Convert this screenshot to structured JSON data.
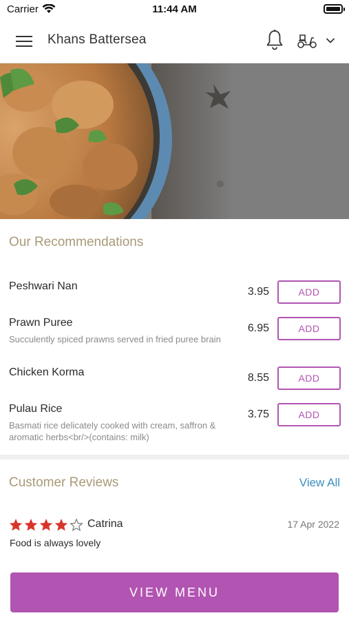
{
  "status_bar": {
    "carrier": "Carrier",
    "time": "11:44 AM"
  },
  "header": {
    "title": "Khans Battersea",
    "icons": [
      "menu-icon",
      "bell-icon",
      "scooter-icon",
      "chevron-down-icon"
    ]
  },
  "recommendations": {
    "title": "Our Recommendations",
    "add_label": "ADD",
    "items": [
      {
        "name": "Peshwari Nan",
        "description": "",
        "price": "3.95"
      },
      {
        "name": "Prawn Puree",
        "description": "Succulently spiced prawns served in fried puree brain",
        "price": "6.95"
      },
      {
        "name": "Chicken Korma",
        "description": "",
        "price": "8.55"
      },
      {
        "name": "Pulau Rice",
        "description": "Basmati rice delicately cooked with cream, saffron & aromatic herbs<br/>(contains: milk)",
        "price": "3.75"
      }
    ]
  },
  "reviews": {
    "title": "Customer Reviews",
    "view_all": "View All",
    "items": [
      {
        "rating": 4,
        "max_rating": 5,
        "reviewer": "Catrina",
        "date": "17 Apr 2022",
        "text": "Food is always lovely"
      }
    ]
  },
  "cta": {
    "label": "VIEW MENU"
  },
  "colors": {
    "accent": "#b254b2",
    "section_title": "#a89a78",
    "link": "#3a8fc0",
    "star": "#d9342b"
  }
}
